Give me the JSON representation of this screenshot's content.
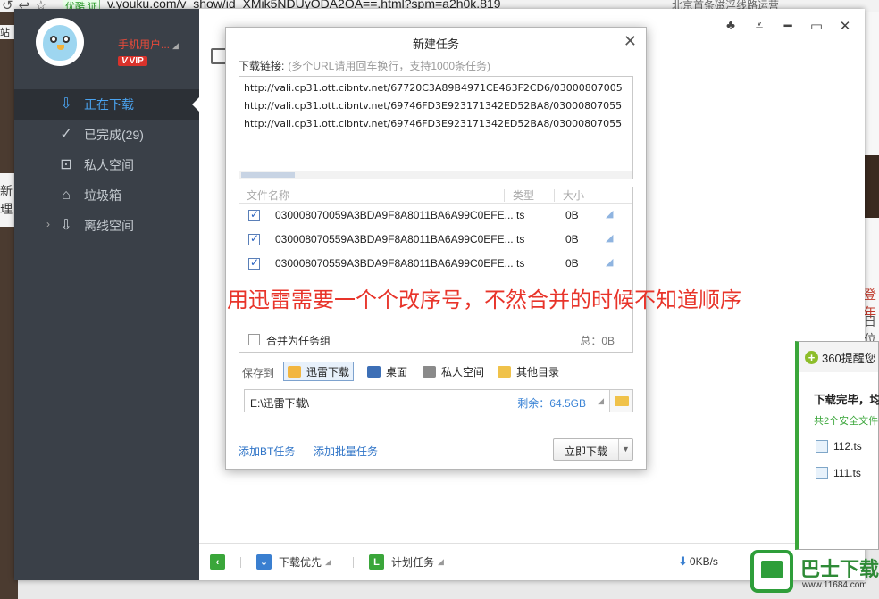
{
  "browser": {
    "badge": "优酷 证",
    "url": "v.youku.com/v_show/id_XMik5NDUyODA2OA==.html?spm=a2h0k.819",
    "hint": "北京首条磁浮线路运营"
  },
  "user": {
    "name": "手机用户...",
    "vip": "VIP"
  },
  "sidebar": {
    "items": [
      {
        "label": "正在下载",
        "icon": "download-icon",
        "glyph": "⇩"
      },
      {
        "label": "已完成(29)",
        "icon": "check-circle-icon",
        "glyph": "✓"
      },
      {
        "label": "私人空间",
        "icon": "lock-icon",
        "glyph": "🔒"
      },
      {
        "label": "垃圾箱",
        "icon": "trash-icon",
        "glyph": "🗑"
      },
      {
        "label": "离线空间",
        "icon": "cloud-icon",
        "glyph": "☁"
      }
    ]
  },
  "dialog": {
    "title": "新建任务",
    "link_label": "下载链接:",
    "link_hint": "(多个URL请用回车换行，支持1000条任务)",
    "urls": [
      "http://vali.cp31.ott.cibntv.net/67720C3A89B4971CE463F2CD6/03000807005",
      "http://vali.cp31.ott.cibntv.net/69746FD3E923171342ED52BA8/03000807055",
      "http://vali.cp31.ott.cibntv.net/69746FD3E923171342ED52BA8/03000807055"
    ],
    "columns": {
      "name": "文件名称",
      "type": "类型",
      "size": "大小"
    },
    "files": [
      {
        "name": "030008070059A3BDA9F8A8011BA6A99C0EFE...",
        "type": "ts",
        "size": "0B"
      },
      {
        "name": "030008070559A3BDA9F8A8011BA6A99C0EFE...",
        "type": "ts",
        "size": "0B"
      },
      {
        "name": "030008070559A3BDA9F8A8011BA6A99C0EFE...",
        "type": "ts",
        "size": "0B"
      }
    ],
    "annotation": "用迅雷需要一个个改序号，不然合并的时候不知道顺序",
    "merge_label": "合并为任务组",
    "total": "总：0B",
    "save_to": "保存到",
    "save_options": [
      {
        "label": "迅雷下载",
        "color": "#f2b640"
      },
      {
        "label": "桌面",
        "color": "#3d6fb6"
      },
      {
        "label": "私人空间",
        "color": "#8a8a8a"
      },
      {
        "label": "其他目录",
        "color": "#f0c24a"
      }
    ],
    "path": "E:\\迅雷下载\\",
    "free": "剩余：64.5GB",
    "add_bt": "添加BT任务",
    "add_batch": "添加批量任务",
    "download_now": "立即下载"
  },
  "statusbar": {
    "priority": "下载优先",
    "plan": "计划任务",
    "speed": "0KB/s"
  },
  "notify": {
    "header": "360提醒您",
    "title": "下载完毕，均",
    "sub": "共2个安全文件",
    "files": [
      "112.ts",
      "111.ts"
    ]
  },
  "watermark": {
    "name": "巴士下载",
    "url": "www.11684.com"
  },
  "colors": {
    "sidebar_bg": "#3a4048",
    "accent_blue": "#4aa3f0",
    "annotation_red": "#e8342a",
    "green": "#3aa63a"
  }
}
